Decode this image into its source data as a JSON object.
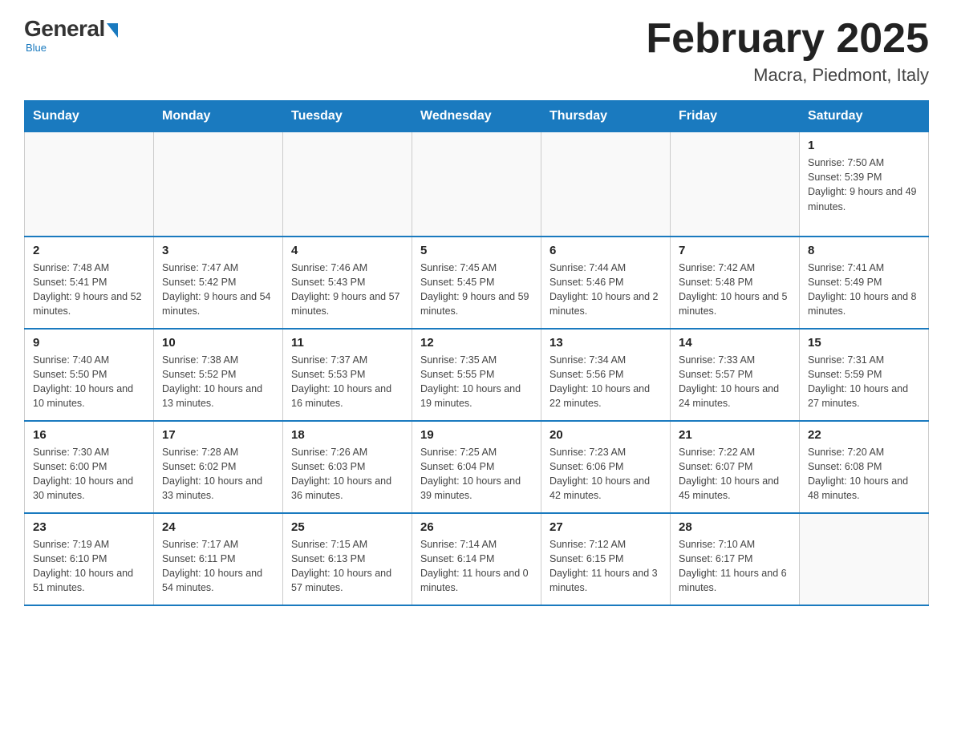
{
  "logo": {
    "general": "General",
    "blue": "Blue",
    "subtitle": "Blue"
  },
  "title": "February 2025",
  "location": "Macra, Piedmont, Italy",
  "days_of_week": [
    "Sunday",
    "Monday",
    "Tuesday",
    "Wednesday",
    "Thursday",
    "Friday",
    "Saturday"
  ],
  "weeks": [
    [
      {
        "num": "",
        "info": ""
      },
      {
        "num": "",
        "info": ""
      },
      {
        "num": "",
        "info": ""
      },
      {
        "num": "",
        "info": ""
      },
      {
        "num": "",
        "info": ""
      },
      {
        "num": "",
        "info": ""
      },
      {
        "num": "1",
        "info": "Sunrise: 7:50 AM\nSunset: 5:39 PM\nDaylight: 9 hours and 49 minutes."
      }
    ],
    [
      {
        "num": "2",
        "info": "Sunrise: 7:48 AM\nSunset: 5:41 PM\nDaylight: 9 hours and 52 minutes."
      },
      {
        "num": "3",
        "info": "Sunrise: 7:47 AM\nSunset: 5:42 PM\nDaylight: 9 hours and 54 minutes."
      },
      {
        "num": "4",
        "info": "Sunrise: 7:46 AM\nSunset: 5:43 PM\nDaylight: 9 hours and 57 minutes."
      },
      {
        "num": "5",
        "info": "Sunrise: 7:45 AM\nSunset: 5:45 PM\nDaylight: 9 hours and 59 minutes."
      },
      {
        "num": "6",
        "info": "Sunrise: 7:44 AM\nSunset: 5:46 PM\nDaylight: 10 hours and 2 minutes."
      },
      {
        "num": "7",
        "info": "Sunrise: 7:42 AM\nSunset: 5:48 PM\nDaylight: 10 hours and 5 minutes."
      },
      {
        "num": "8",
        "info": "Sunrise: 7:41 AM\nSunset: 5:49 PM\nDaylight: 10 hours and 8 minutes."
      }
    ],
    [
      {
        "num": "9",
        "info": "Sunrise: 7:40 AM\nSunset: 5:50 PM\nDaylight: 10 hours and 10 minutes."
      },
      {
        "num": "10",
        "info": "Sunrise: 7:38 AM\nSunset: 5:52 PM\nDaylight: 10 hours and 13 minutes."
      },
      {
        "num": "11",
        "info": "Sunrise: 7:37 AM\nSunset: 5:53 PM\nDaylight: 10 hours and 16 minutes."
      },
      {
        "num": "12",
        "info": "Sunrise: 7:35 AM\nSunset: 5:55 PM\nDaylight: 10 hours and 19 minutes."
      },
      {
        "num": "13",
        "info": "Sunrise: 7:34 AM\nSunset: 5:56 PM\nDaylight: 10 hours and 22 minutes."
      },
      {
        "num": "14",
        "info": "Sunrise: 7:33 AM\nSunset: 5:57 PM\nDaylight: 10 hours and 24 minutes."
      },
      {
        "num": "15",
        "info": "Sunrise: 7:31 AM\nSunset: 5:59 PM\nDaylight: 10 hours and 27 minutes."
      }
    ],
    [
      {
        "num": "16",
        "info": "Sunrise: 7:30 AM\nSunset: 6:00 PM\nDaylight: 10 hours and 30 minutes."
      },
      {
        "num": "17",
        "info": "Sunrise: 7:28 AM\nSunset: 6:02 PM\nDaylight: 10 hours and 33 minutes."
      },
      {
        "num": "18",
        "info": "Sunrise: 7:26 AM\nSunset: 6:03 PM\nDaylight: 10 hours and 36 minutes."
      },
      {
        "num": "19",
        "info": "Sunrise: 7:25 AM\nSunset: 6:04 PM\nDaylight: 10 hours and 39 minutes."
      },
      {
        "num": "20",
        "info": "Sunrise: 7:23 AM\nSunset: 6:06 PM\nDaylight: 10 hours and 42 minutes."
      },
      {
        "num": "21",
        "info": "Sunrise: 7:22 AM\nSunset: 6:07 PM\nDaylight: 10 hours and 45 minutes."
      },
      {
        "num": "22",
        "info": "Sunrise: 7:20 AM\nSunset: 6:08 PM\nDaylight: 10 hours and 48 minutes."
      }
    ],
    [
      {
        "num": "23",
        "info": "Sunrise: 7:19 AM\nSunset: 6:10 PM\nDaylight: 10 hours and 51 minutes."
      },
      {
        "num": "24",
        "info": "Sunrise: 7:17 AM\nSunset: 6:11 PM\nDaylight: 10 hours and 54 minutes."
      },
      {
        "num": "25",
        "info": "Sunrise: 7:15 AM\nSunset: 6:13 PM\nDaylight: 10 hours and 57 minutes."
      },
      {
        "num": "26",
        "info": "Sunrise: 7:14 AM\nSunset: 6:14 PM\nDaylight: 11 hours and 0 minutes."
      },
      {
        "num": "27",
        "info": "Sunrise: 7:12 AM\nSunset: 6:15 PM\nDaylight: 11 hours and 3 minutes."
      },
      {
        "num": "28",
        "info": "Sunrise: 7:10 AM\nSunset: 6:17 PM\nDaylight: 11 hours and 6 minutes."
      },
      {
        "num": "",
        "info": ""
      }
    ]
  ]
}
